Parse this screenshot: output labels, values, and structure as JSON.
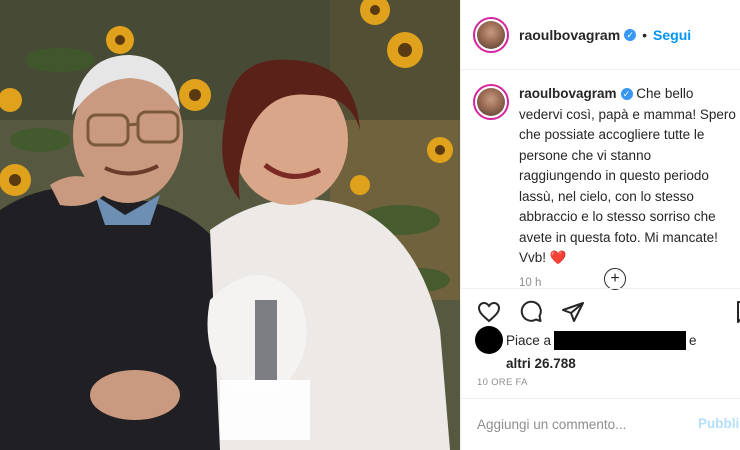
{
  "post": {
    "username": "raoulbovagram",
    "follow_label": "Segui",
    "separator": "•",
    "caption": "Che bello vedervi così, papà e mamma! Spero che possiate accogliere tutte le persone che vi stanno raggiungendo in questo periodo lassù, nel cielo, con lo stesso abbraccio e lo stesso sorriso che avete in questa foto. Mi mancate! Vvb!",
    "caption_emoji": "❤️",
    "time": "10 h",
    "likes_prefix": "Piace a",
    "likes_suffix": "e",
    "likes_others": "altri 26.788",
    "posted_ago": "10 ORE FA"
  },
  "comment": {
    "placeholder": "Aggiungi un commento...",
    "publish_label": "Pubblica"
  },
  "icons": {
    "load_more": "plus-circle-icon",
    "like": "heart-icon",
    "comment": "comment-bubble-icon",
    "share": "paper-plane-icon",
    "save": "bookmark-icon",
    "verified": "verified-badge-icon"
  },
  "colors": {
    "follow": "#0095f6",
    "verified": "#3897f0",
    "publish_disabled": "#b2dffc",
    "muted": "#8e8e8e"
  }
}
